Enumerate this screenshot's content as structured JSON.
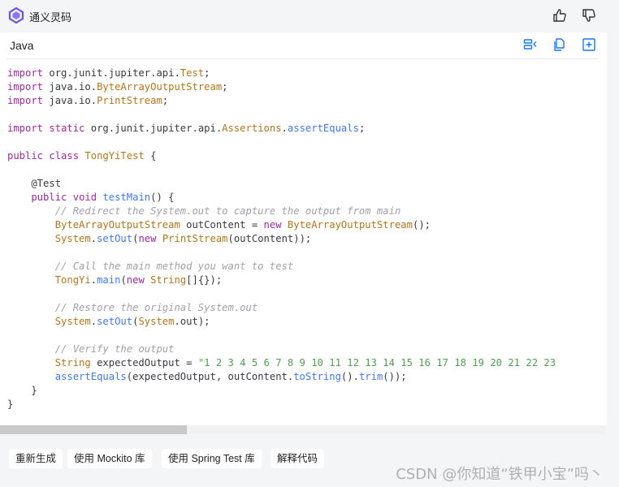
{
  "header": {
    "brand": "通义灵码",
    "logo_icon": "tongyi-logo-icon",
    "thumbs_up_icon": "thumbs-up-icon",
    "thumbs_down_icon": "thumbs-down-icon"
  },
  "code_block": {
    "language": "Java",
    "tools": [
      "insert-code-icon",
      "copy-icon",
      "new-file-icon"
    ],
    "lines": [
      "import org.junit.jupiter.api.Test;",
      "import java.io.ByteArrayOutputStream;",
      "import java.io.PrintStream;",
      "",
      "import static org.junit.jupiter.api.Assertions.assertEquals;",
      "",
      "public class TongYiTest {",
      "",
      "    @Test",
      "    public void testMain() {",
      "        // Redirect the System.out to capture the output from main",
      "        ByteArrayOutputStream outContent = new ByteArrayOutputStream();",
      "        System.setOut(new PrintStream(outContent));",
      "",
      "        // Call the main method you want to test",
      "        TongYi.main(new String[]{});",
      "",
      "        // Restore the original System.out",
      "        System.setOut(System.out);",
      "",
      "        // Verify the output",
      "        String expectedOutput = \"1 2 3 4 5 6 7 8 9 10 11 12 13 14 15 16 17 18 19 20 21 22 23",
      "        assertEquals(expectedOutput, outContent.toString().trim());",
      "    }",
      "}"
    ]
  },
  "actions": [
    "重新生成",
    "使用 Mockito 库",
    "使用 Spring Test 库",
    "解释代码"
  ],
  "watermark": "CSDN @你知道“铁甲小宝”吗丶",
  "colors": {
    "keyword": "#a626a4",
    "type": "#b5751a",
    "function": "#4078f2",
    "string": "#50a14f",
    "comment": "#a0a1a7",
    "accent": "#1677ff"
  }
}
